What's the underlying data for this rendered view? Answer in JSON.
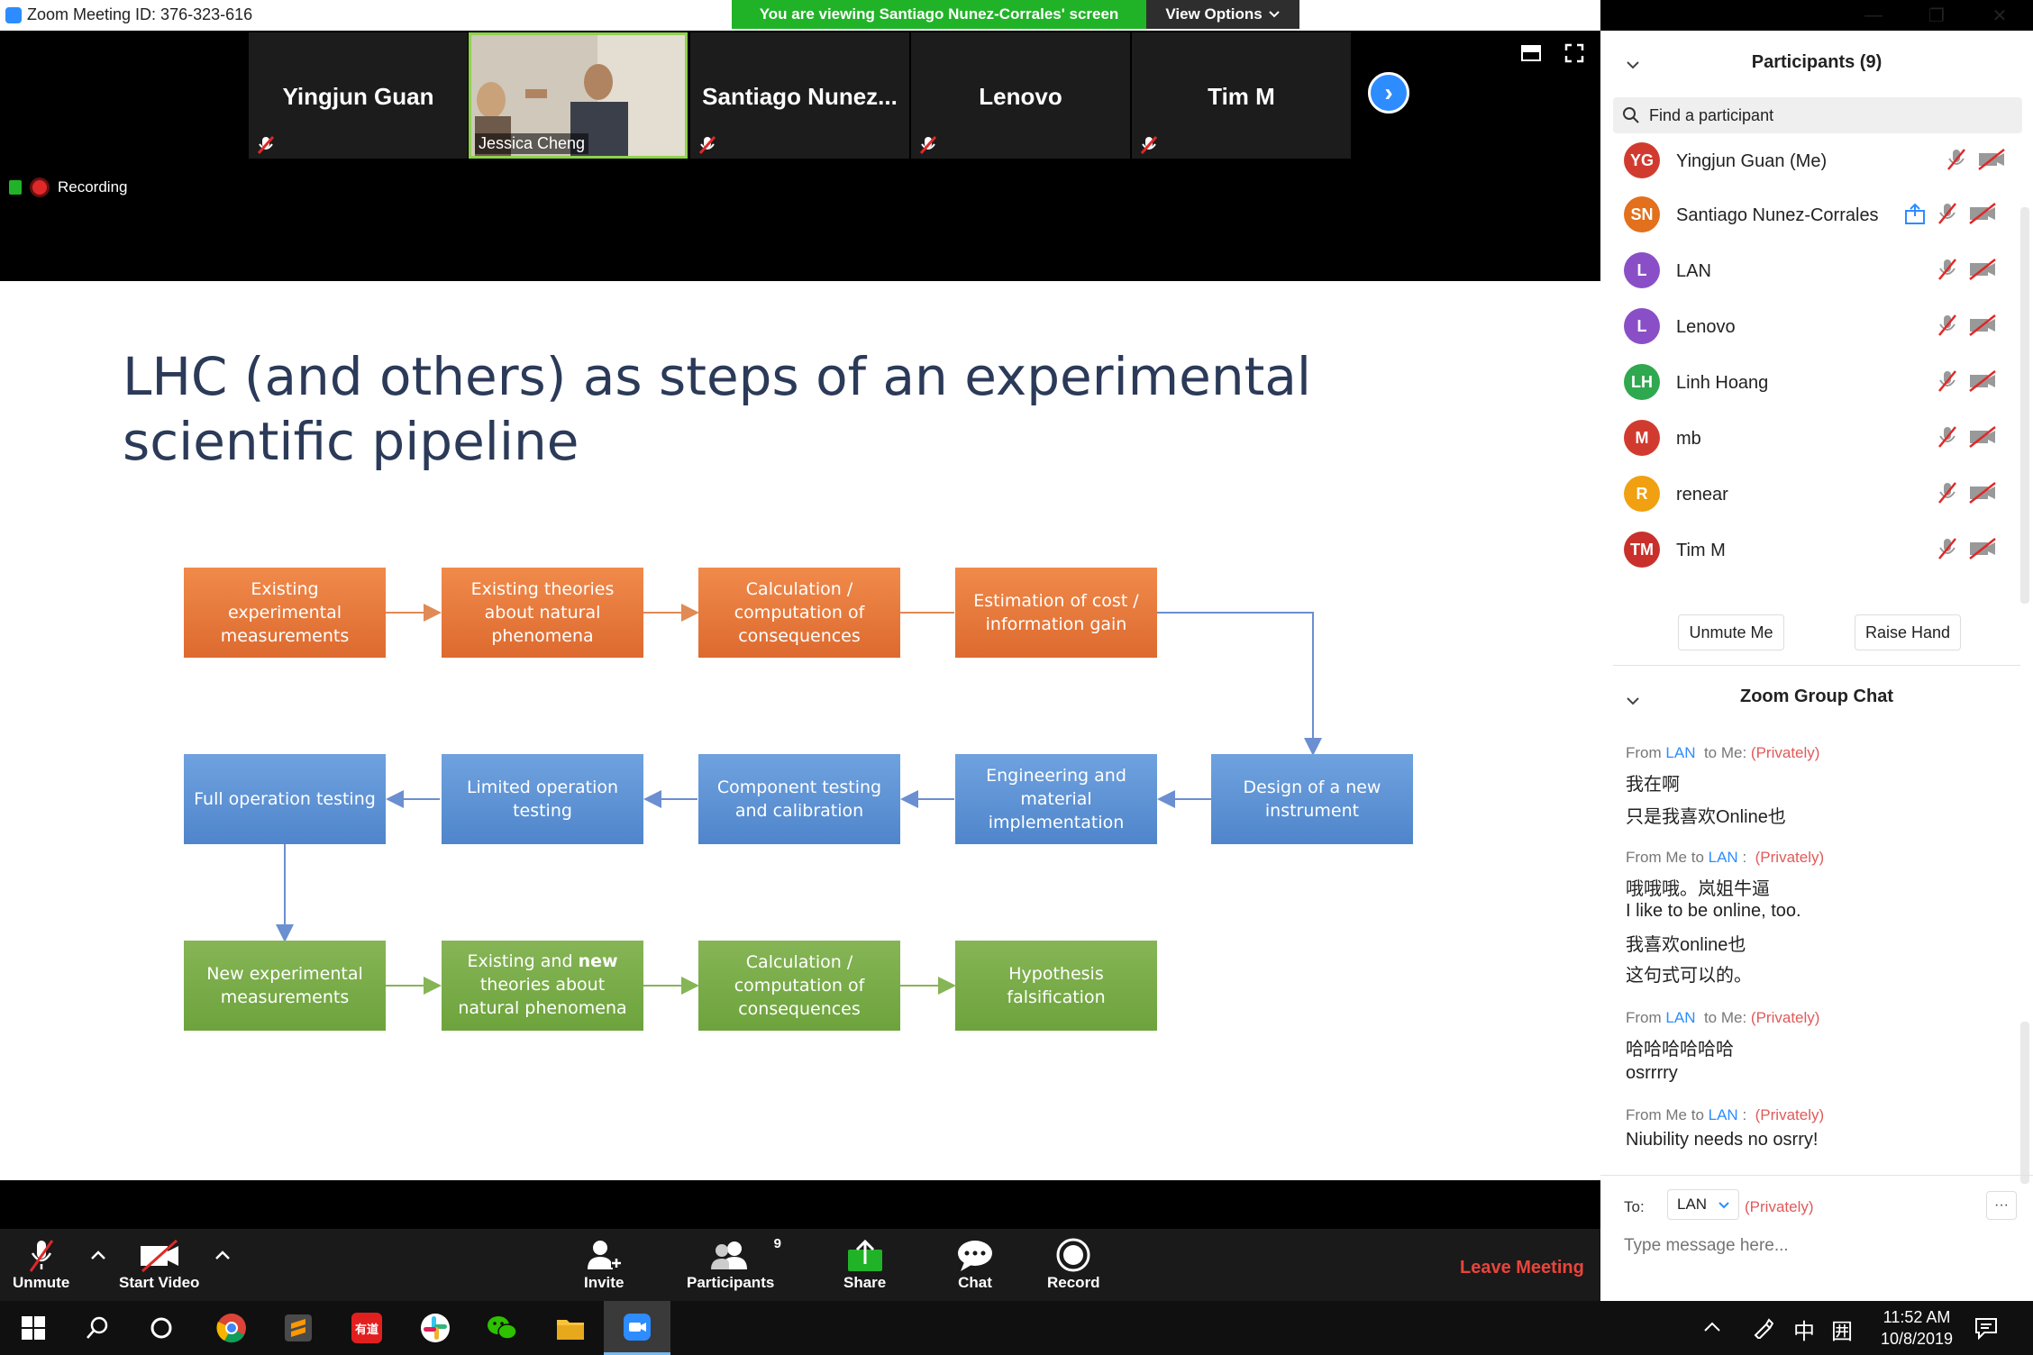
{
  "window": {
    "title": "Zoom Meeting ID: 376-323-616",
    "viewing_banner": "You are viewing Santiago Nunez-Corrales' screen",
    "view_options": "View Options",
    "minimize": "—",
    "restore": "❐",
    "close": "✕"
  },
  "video_tiles": [
    {
      "name": "Yingjun Guan"
    },
    {
      "name": "Jessica Cheng"
    },
    {
      "name": "Santiago  Nunez..."
    },
    {
      "name": "Lenovo"
    },
    {
      "name": "Tim M"
    }
  ],
  "recording_label": "Recording",
  "slide": {
    "title": "LHC (and others) as steps of an experimental scientific pipeline",
    "row1": [
      "Existing experimental measurements",
      "Existing theories about natural phenomena",
      "Calculation / computation of consequences",
      "Estimation of cost / information gain"
    ],
    "row2": [
      "Full operation testing",
      "Limited operation testing",
      "Component testing and calibration",
      "Engineering and material implementation",
      "Design of a new instrument"
    ],
    "row3_first": "New experimental measurements",
    "row3_second_pre": "Existing and ",
    "row3_second_bold": "new",
    "row3_second_post": " theories about natural phenomena",
    "row3_third": "Calculation / computation of consequences",
    "row3_fourth": "Hypothesis falsification"
  },
  "participants": {
    "header": "Participants (9)",
    "search_placeholder": "Find a participant",
    "list": [
      {
        "initials": "YG",
        "name": "Yingjun Guan (Me)",
        "color": "#d13b2f"
      },
      {
        "initials": "SN",
        "name": "Santiago Nunez-Corrales",
        "color": "#e2701c"
      },
      {
        "initials": "L",
        "name": "LAN",
        "color": "#8a4fc7"
      },
      {
        "initials": "L",
        "name": "Lenovo",
        "color": "#8a4fc7"
      },
      {
        "initials": "LH",
        "name": "Linh Hoang",
        "color": "#2fa84f"
      },
      {
        "initials": "M",
        "name": "mb",
        "color": "#d13b2f"
      },
      {
        "initials": "R",
        "name": "renear",
        "color": "#f0a010"
      },
      {
        "initials": "TM",
        "name": "Tim M",
        "color": "#c9302c"
      }
    ],
    "unmute_me": "Unmute Me",
    "raise_hand": "Raise Hand"
  },
  "chat": {
    "header": "Zoom Group Chat",
    "from": "From",
    "from_me_to": "From Me to",
    "to_me": "to Me:",
    "peer": "LAN",
    "peer_colon": "LAN",
    "colon": ":",
    "privately": "(Privately)",
    "messages": {
      "m1": [
        "我在啊",
        "只是我喜欢Online也"
      ],
      "m2": [
        "哦哦哦。岚姐牛逼",
        "I like to be online, too.",
        "我喜欢online也",
        "这句式可以的。"
      ],
      "m3": [
        "哈哈哈哈哈哈",
        "osrrrry"
      ],
      "m4": [
        "Niubility needs no osrry!"
      ]
    },
    "to_label": "To:",
    "recipient": "LAN",
    "recipient_mode": "(Privately)",
    "input_placeholder": "Type message here...",
    "more": "···"
  },
  "toolbar": {
    "unmute": "Unmute",
    "start_video": "Start Video",
    "invite": "Invite",
    "participants": "Participants",
    "participants_count": "9",
    "share": "Share",
    "chat": "Chat",
    "record": "Record",
    "leave": "Leave Meeting"
  },
  "taskbar": {
    "time": "11:52 AM",
    "date": "10/8/2019",
    "ime": "中",
    "ime_mode": "囲",
    "youdao": "有道"
  }
}
